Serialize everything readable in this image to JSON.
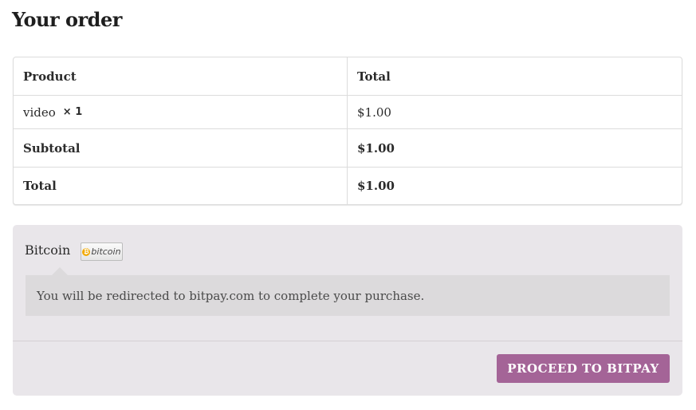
{
  "heading": "Your order",
  "table": {
    "headers": {
      "product": "Product",
      "total": "Total"
    },
    "item": {
      "name": "video",
      "quantity": "× 1",
      "total": "$1.00"
    },
    "subtotal": {
      "label": "Subtotal",
      "value": "$1.00"
    },
    "total": {
      "label": "Total",
      "value": "$1.00"
    }
  },
  "payment": {
    "method_label": "Bitcoin",
    "logo_text": "bitcoin",
    "logo_symbol": "₿",
    "notice": "You will be redirected to bitpay.com to complete your purchase.",
    "button_label": "PROCEED TO BITPAY"
  },
  "colors": {
    "button": "#a46497",
    "payment_bg": "#e9e6ea",
    "notice_bg": "#dcdadc",
    "bitcoin_orange": "#f2a900"
  },
  "icons": {
    "logo": "bitcoin-logo-icon"
  }
}
